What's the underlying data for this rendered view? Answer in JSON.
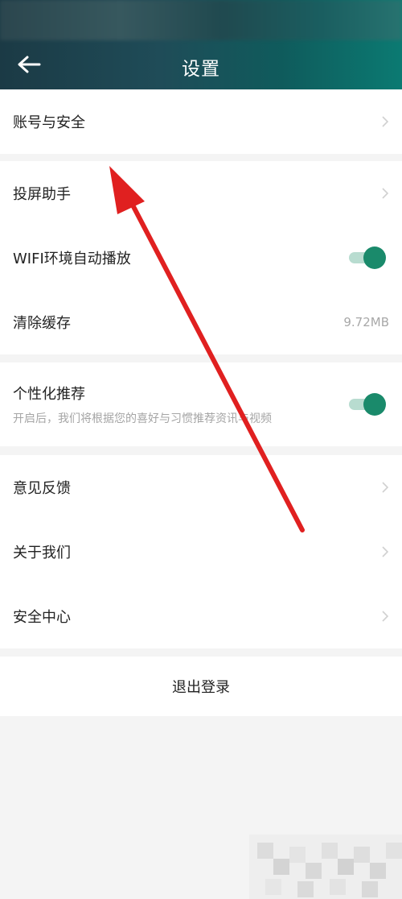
{
  "header": {
    "title": "设置",
    "back_icon": "arrow-left-icon"
  },
  "sections": [
    {
      "items": [
        {
          "label": "账号与安全",
          "type": "link",
          "icon": "chevron-right-icon"
        }
      ]
    },
    {
      "items": [
        {
          "label": "投屏助手",
          "type": "link",
          "icon": "chevron-right-icon"
        },
        {
          "label": "WIFI环境自动播放",
          "type": "toggle",
          "on": true
        },
        {
          "label": "清除缓存",
          "type": "value",
          "value": "9.72MB"
        }
      ]
    },
    {
      "items": [
        {
          "label": "个性化推荐",
          "sublabel": "开启后，我们将根据您的喜好与习惯推荐资讯与视频",
          "type": "toggle",
          "on": true
        }
      ]
    },
    {
      "items": [
        {
          "label": "意见反馈",
          "type": "link",
          "icon": "chevron-right-icon"
        },
        {
          "label": "关于我们",
          "type": "link",
          "icon": "chevron-right-icon"
        },
        {
          "label": "安全中心",
          "type": "link",
          "icon": "chevron-right-icon"
        }
      ]
    }
  ],
  "logout": {
    "label": "退出登录"
  },
  "colors": {
    "accent": "#1a8a6b",
    "toggle_track": "#b8dcd0",
    "annotation_arrow": "#e02020",
    "background": "#f4f4f4"
  },
  "annotation": {
    "icon": "red-arrow-annotation"
  }
}
